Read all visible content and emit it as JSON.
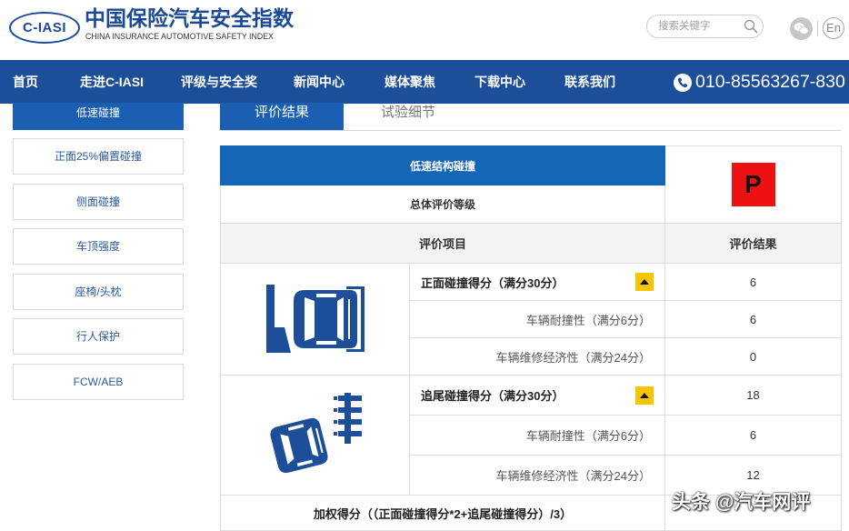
{
  "colors": {
    "brand_blue": "#1a4a96",
    "nav_blue": "#1c4e9a",
    "accent_blue": "#1a5fb1",
    "table_header_blue": "#1566b6",
    "rating_red": "#ee1111",
    "toggle_yellow": "#f7c600"
  },
  "header": {
    "logo_text": "C-IASI",
    "brand_cn": "中国保险汽车安全指数",
    "brand_en": "CHINA INSURANCE AUTOMOTIVE SAFETY INDEX",
    "search_placeholder": "搜索关键字",
    "search_icon": "search-icon",
    "wechat_icon": "wechat-icon",
    "lang_label": "En"
  },
  "nav": {
    "items": [
      "首页",
      "走进C-IASI",
      "评级与安全奖",
      "新闻中心",
      "媒体聚焦",
      "下载中心",
      "联系我们"
    ],
    "phone_icon": "phone-icon",
    "phone": "010-85563267-830"
  },
  "sidebar": {
    "items": [
      {
        "label": "低速碰撞",
        "active": true
      },
      {
        "label": "正面25%偏置碰撞",
        "active": false
      },
      {
        "label": "侧面碰撞",
        "active": false
      },
      {
        "label": "车顶强度",
        "active": false
      },
      {
        "label": "座椅/头枕",
        "active": false
      },
      {
        "label": "行人保护",
        "active": false
      },
      {
        "label": "FCW/AEB",
        "active": false
      }
    ]
  },
  "tabs": [
    {
      "label": "评价结果",
      "active": true
    },
    {
      "label": "试验细节",
      "active": false
    }
  ],
  "table": {
    "section_title": "低速结构碰撞",
    "overall_label": "总体评价等级",
    "overall_rating": "P",
    "col_item": "评价项目",
    "col_result": "评价结果",
    "groups": [
      {
        "icon": "front-crash-illustration",
        "title": "正面碰撞得分（满分30分）",
        "score": "6",
        "rows": [
          {
            "label": "车辆耐撞性（满分6分）",
            "score": "6"
          },
          {
            "label": "车辆维修经济性（满分24分）",
            "score": "0"
          }
        ]
      },
      {
        "icon": "rear-crash-illustration",
        "title": "追尾碰撞得分（满分30分）",
        "score": "18",
        "rows": [
          {
            "label": "车辆耐撞性（满分6分）",
            "score": "6"
          },
          {
            "label": "车辆维修经济性（满分24分）",
            "score": "12"
          }
        ]
      }
    ],
    "weighted_label": "加权得分（（正面碰撞得分*2+追尾碰撞得分）/3）"
  },
  "watermark": "头条 @汽车网评"
}
